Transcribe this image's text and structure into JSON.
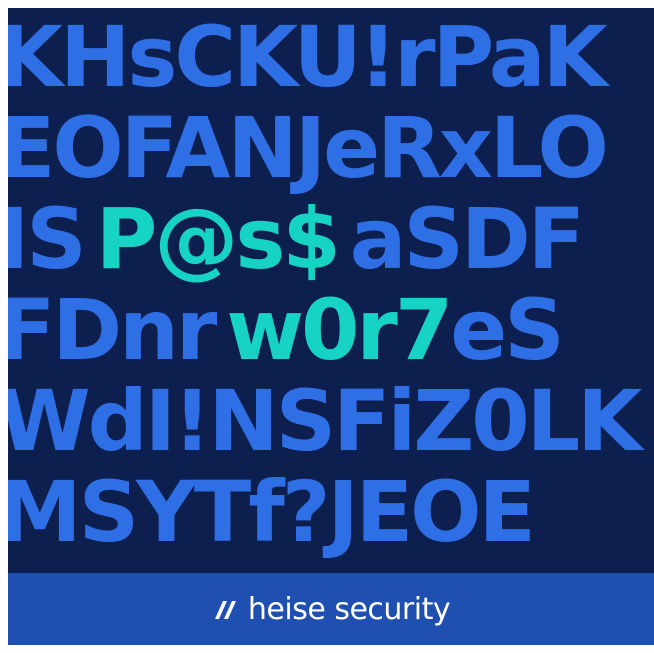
{
  "rows": [
    {
      "pre": "KHsCKU!rPaK",
      "hl": "",
      "post": ""
    },
    {
      "pre": "EOFANJeRxLO",
      "hl": "",
      "post": ""
    },
    {
      "pre": "IS",
      "hl": "P@s$",
      "post": "aSDF"
    },
    {
      "pre": "FDnr",
      "hl": "w0r7",
      "post": "eS"
    },
    {
      "pre": "WdI!NSFiZ0LK",
      "hl": "",
      "post": ""
    },
    {
      "pre": "MSYTf?JEOE",
      "hl": "",
      "post": ""
    }
  ],
  "brand": {
    "name": "heise security",
    "logo_icon": "heise-slash-logo-icon"
  },
  "colors": {
    "background": "#0d1f4f",
    "letters": "#2f6fe6",
    "highlight": "#17d3c4",
    "footer": "#1f4fb0",
    "brand_text": "#ffffff"
  }
}
